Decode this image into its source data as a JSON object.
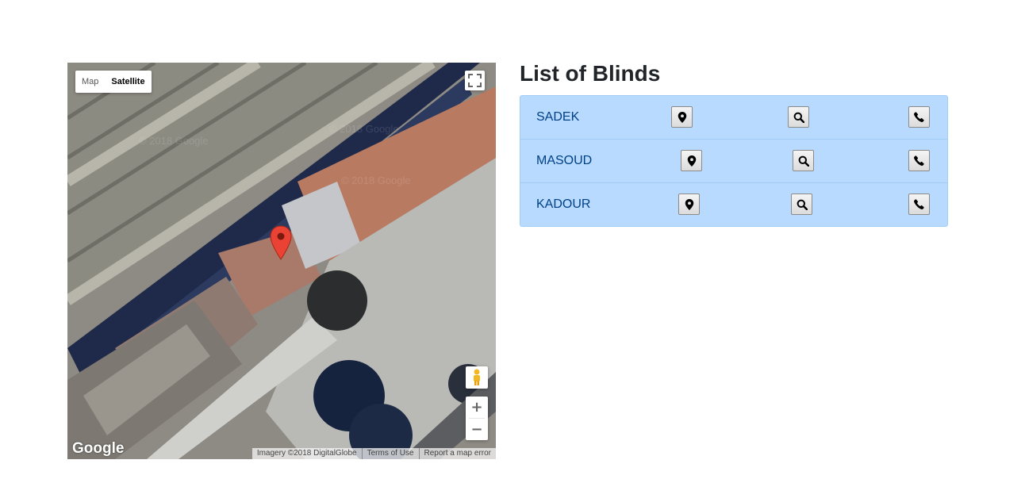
{
  "map": {
    "type_buttons": [
      {
        "label": "Map",
        "active": false
      },
      {
        "label": "Satellite",
        "active": true
      }
    ],
    "zoom_in": "+",
    "zoom_out": "−",
    "logo": "Google",
    "attribution": {
      "imagery": "Imagery ©2018 DigitalGlobe",
      "terms": "Terms of Use",
      "report": "Report a map error"
    },
    "icons": [
      "fullscreen-icon",
      "pegman-icon",
      "map-marker-icon"
    ]
  },
  "list": {
    "title": "List of Blinds",
    "items": [
      {
        "name": "SADEK"
      },
      {
        "name": "MASOUD"
      },
      {
        "name": "KADOUR"
      }
    ],
    "row_icons": [
      "map-pin-icon",
      "search-icon",
      "phone-icon"
    ]
  },
  "colors": {
    "list_bg": "#b8daff",
    "list_border": "#9fcdf5",
    "name_text": "#004085",
    "marker_red": "#ea4335"
  }
}
